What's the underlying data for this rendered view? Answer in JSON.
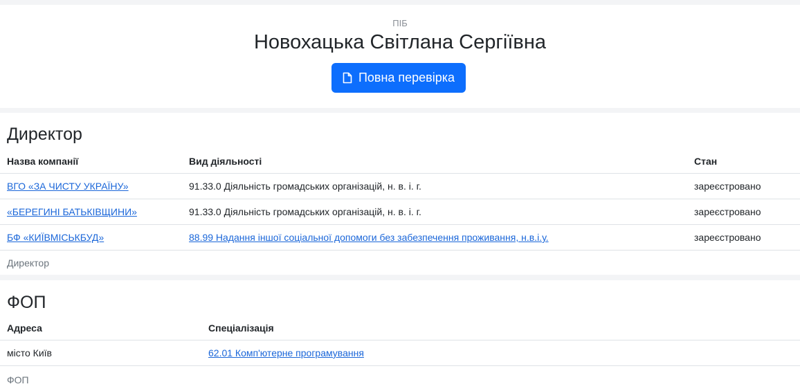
{
  "header": {
    "label": "ПІБ",
    "full_name": "Новохацька Світлана Сергіївна",
    "check_button_label": "Повна перевірка"
  },
  "director": {
    "title": "Директор",
    "columns": {
      "company": "Назва компанії",
      "activity": "Вид діяльності",
      "status": "Стан"
    },
    "rows": [
      {
        "company": "ВГО «ЗА ЧИСТУ УКРАЇНУ»",
        "activity": "91.33.0 Діяльність громадських організацій, н. в. і. г.",
        "status": "зареєстровано"
      },
      {
        "company": "«БЕРЕГИНІ БАТЬКІВЩИНИ»",
        "activity": "91.33.0 Діяльність громадських організацій, н. в. і. г.",
        "status": "зареєстровано"
      },
      {
        "company": "БФ «КИЇВМІСЬКБУД»",
        "activity": "88.99 Надання іншої соціальної допомоги без забезпечення проживання, н.в.і.у.",
        "status": "зареєстровано"
      }
    ],
    "footer": "Директор"
  },
  "fop": {
    "title": "ФОП",
    "columns": {
      "address": "Адреса",
      "specialization": "Спеціалізація"
    },
    "rows": [
      {
        "address": "місто Київ",
        "specialization": "62.01 Комп'ютерне програмування"
      }
    ],
    "footer": "ФОП"
  },
  "colors": {
    "accent": "#0d6efd",
    "link": "#1a66d9",
    "page_background": "#f3f4f6"
  },
  "icons": {
    "check_button": "document-icon"
  }
}
